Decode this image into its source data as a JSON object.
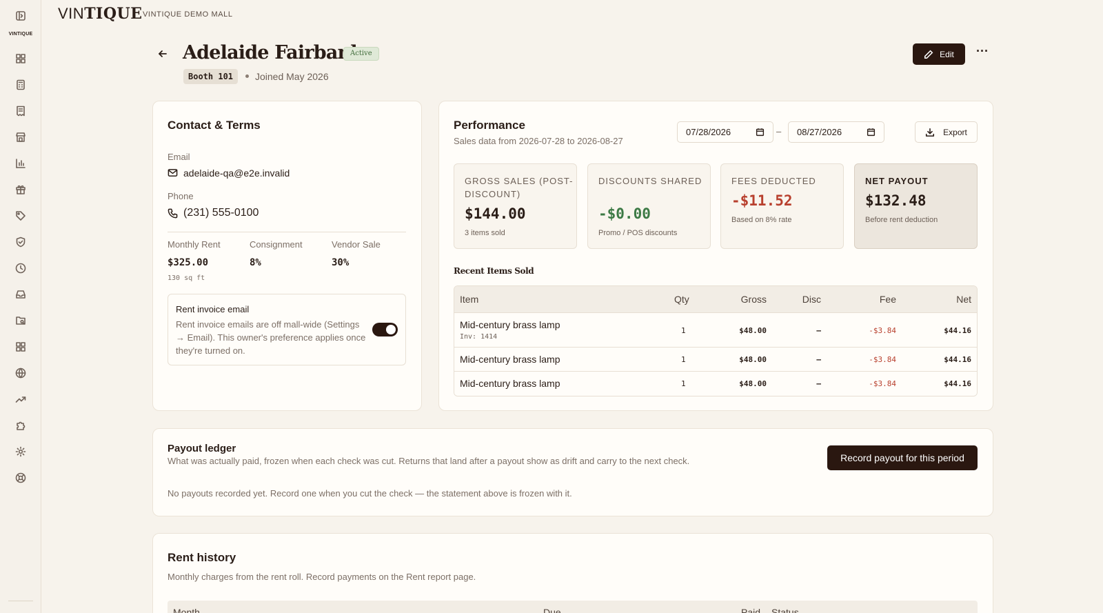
{
  "brand": {
    "name_light": "VIN",
    "name_bold": "TIQUE",
    "mall": "VINTIQUE DEMO MALL",
    "sidebar_logo": "VINTIQUE"
  },
  "header": {
    "owner_name": "Adelaide Fairbanks",
    "status": "Active",
    "booth": "Booth 101",
    "joined": "Joined May 2026",
    "edit_label": "Edit",
    "more_label": "···"
  },
  "sidebar": {
    "icons": [
      "panel-toggle-icon",
      "dashboard-icon",
      "calculator-icon",
      "receipt-icon",
      "store-icon",
      "bar-chart-icon",
      "gift-icon",
      "tag-icon",
      "shield-check-icon",
      "clock-icon",
      "inbox-icon",
      "folder-search-icon",
      "grid-icon",
      "globe-icon",
      "trending-up-icon",
      "puzzle-icon",
      "settings-icon",
      "help-circle-icon"
    ]
  },
  "contact": {
    "title": "Contact & Terms",
    "email_label": "Email",
    "email": "adelaide-qa@e2e.invalid",
    "phone_label": "Phone",
    "phone": "(231) 555-0100",
    "rent_label": "Monthly Rent",
    "rent": "$325.00",
    "size": "130 sq ft",
    "consign_label": "Consignment",
    "consign": "8%",
    "vendor_label": "Vendor Sale",
    "vendor": "30%",
    "invoice_title": "Rent invoice email",
    "invoice_text": "Rent invoice emails are off mall-wide (Settings → Email). This owner's preference applies once they're turned on.",
    "invoice_enabled": true
  },
  "performance": {
    "title": "Performance",
    "subtitle": "Sales data from 2026-07-28 to 2026-08-27",
    "date_from": "07/28/2026",
    "date_sep": "–",
    "date_to": "08/27/2026",
    "export_label": "Export",
    "stats": [
      {
        "label": "Gross Sales (Post-Discount)",
        "value": "$144.00",
        "sub": "3 items sold",
        "color": "#2a1d17"
      },
      {
        "label": "Discounts Shared",
        "value": "-$0.00",
        "sub": "Promo / POS discounts",
        "color": "#3d7a45"
      },
      {
        "label": "Fees Deducted",
        "value": "-$11.52",
        "sub": "Based on 8% rate",
        "color": "#b8402e"
      },
      {
        "label": "Net Payout",
        "value": "$132.48",
        "sub": "Before rent deduction",
        "color": "#2a1d17"
      }
    ],
    "recent_title": "Recent Items Sold",
    "columns": {
      "item": "Item",
      "qty": "Qty",
      "gross": "Gross",
      "disc": "Disc",
      "fee": "Fee",
      "net": "Net"
    },
    "rows": [
      {
        "item": "Mid-century brass lamp",
        "inv": "Inv: 1414",
        "qty": "1",
        "gross": "$48.00",
        "disc": "—",
        "fee": "-$3.84",
        "net": "$44.16"
      },
      {
        "item": "Mid-century brass lamp",
        "inv": "",
        "qty": "1",
        "gross": "$48.00",
        "disc": "—",
        "fee": "-$3.84",
        "net": "$44.16"
      },
      {
        "item": "Mid-century brass lamp",
        "inv": "",
        "qty": "1",
        "gross": "$48.00",
        "disc": "—",
        "fee": "-$3.84",
        "net": "$44.16"
      }
    ]
  },
  "ledger": {
    "title": "Payout ledger",
    "subtitle": "What was actually paid, frozen when each check was cut. Returns that land after a payout show as drift and carry to the next check.",
    "button": "Record payout for this period",
    "empty": "No payouts recorded yet. Record one when you cut the check — the statement above is frozen with it."
  },
  "rent_history": {
    "title": "Rent history",
    "subtitle": "Monthly charges from the rent roll. Record payments on the Rent report page.",
    "columns": {
      "month": "Month",
      "due": "Due",
      "paid": "Paid",
      "status": "Status"
    }
  }
}
